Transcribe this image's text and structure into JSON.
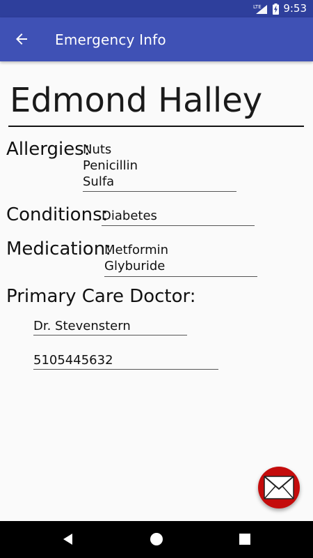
{
  "status_bar": {
    "network": "LTE",
    "time": "9:53",
    "background_color": "#2e3f9c"
  },
  "app_bar": {
    "title": "Emergency Info",
    "back_icon": "arrow-back-icon",
    "background_color": "#3f51b5"
  },
  "profile": {
    "name": "Edmond Halley"
  },
  "allergies": {
    "label": "Allergies:",
    "items": [
      "Nuts",
      "Penicillin",
      "Sulfa"
    ]
  },
  "conditions": {
    "label": "Conditions:",
    "items": [
      "Diabetes"
    ]
  },
  "medication": {
    "label": "Medication:",
    "items": [
      "Metformin",
      "Glyburide"
    ]
  },
  "primary_care": {
    "label": "Primary Care Doctor:",
    "doctor_name": "Dr. Stevenstern",
    "phone": "5105445632"
  },
  "fab": {
    "icon": "envelope-icon",
    "color": "#c40c0c"
  },
  "nav_bar": {
    "back_icon": "nav-back-icon",
    "home_icon": "nav-home-icon",
    "recents_icon": "nav-recents-icon"
  }
}
